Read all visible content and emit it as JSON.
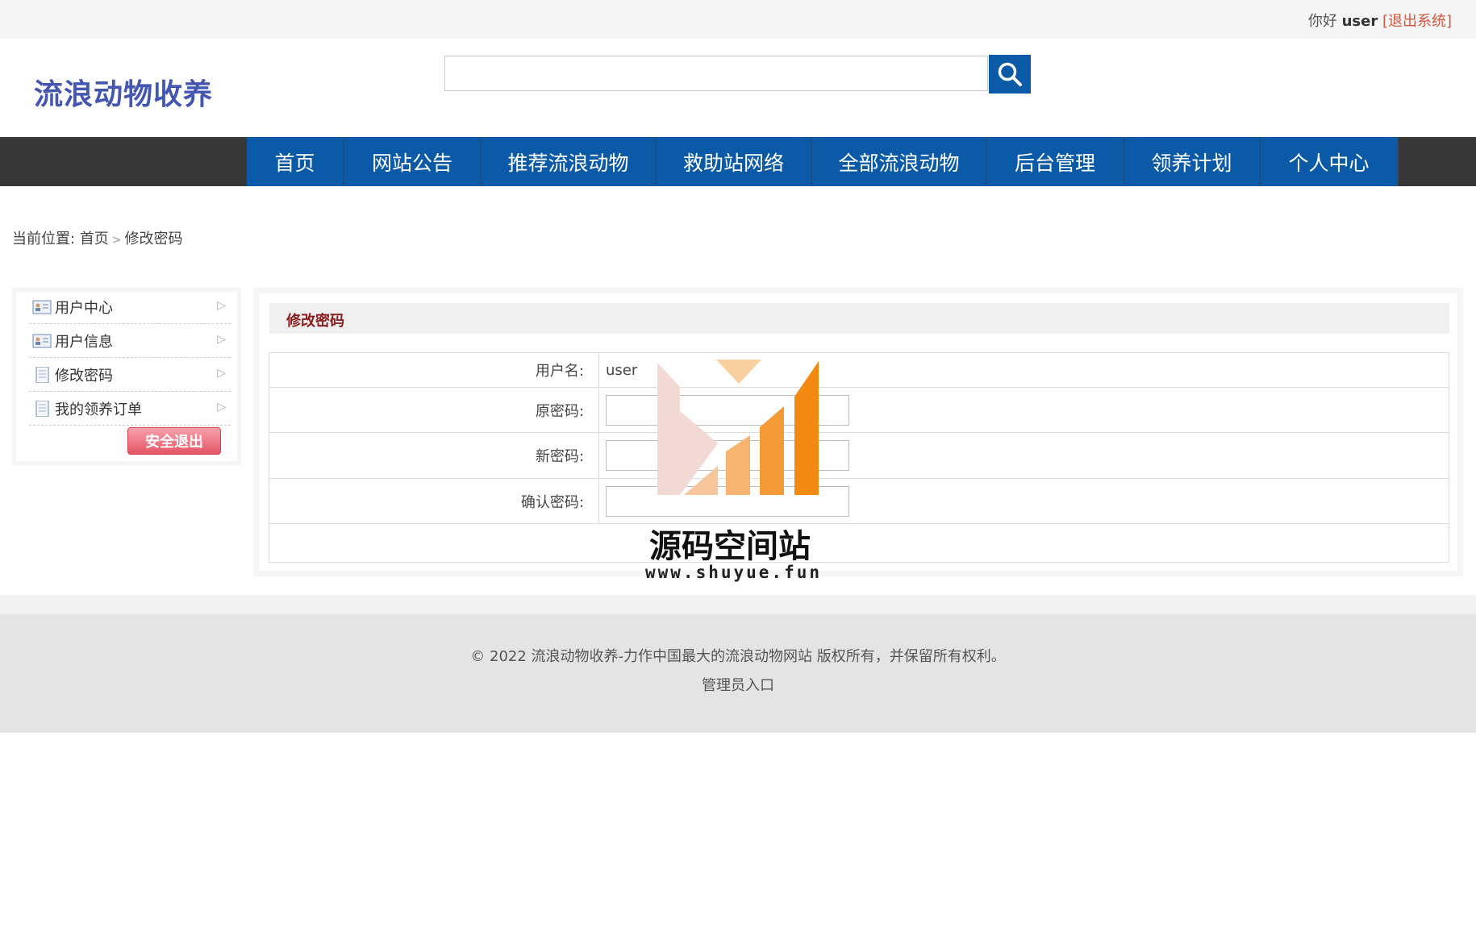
{
  "top": {
    "greeting": "你好",
    "username": "user",
    "logout": "[退出系统]"
  },
  "logo": {
    "text": "流浪动物收养"
  },
  "search": {
    "placeholder": ""
  },
  "nav": [
    "首页",
    "网站公告",
    "推荐流浪动物",
    "救助站网络",
    "全部流浪动物",
    "后台管理",
    "领养计划",
    "个人中心"
  ],
  "breadcrumb": {
    "prefix": "当前位置:",
    "home": "首页",
    "current": "修改密码"
  },
  "sidebar": {
    "items": [
      "用户中心",
      "用户信息",
      "修改密码",
      "我的领养订单"
    ],
    "exit_button": "安全退出"
  },
  "panel": {
    "title": "修改密码",
    "username_label": "用户名:",
    "username_value": "user",
    "old_password_label": "原密码:",
    "new_password_label": "新密码:",
    "confirm_password_label": "确认密码:"
  },
  "footer": {
    "copyright": "© 2022 流浪动物收养-力作中国最大的流浪动物网站 版权所有，并保留所有权利。",
    "admin_link": "管理员入口"
  },
  "watermark": {
    "text": "源码空间站",
    "url": "www.shuyue.fun"
  },
  "colors": {
    "nav_blue": "#0a5aa8",
    "nav_bar": "#373737",
    "logo": "#4356b1",
    "title_red": "#8a1e1e",
    "logout_red": "#d2553f"
  }
}
